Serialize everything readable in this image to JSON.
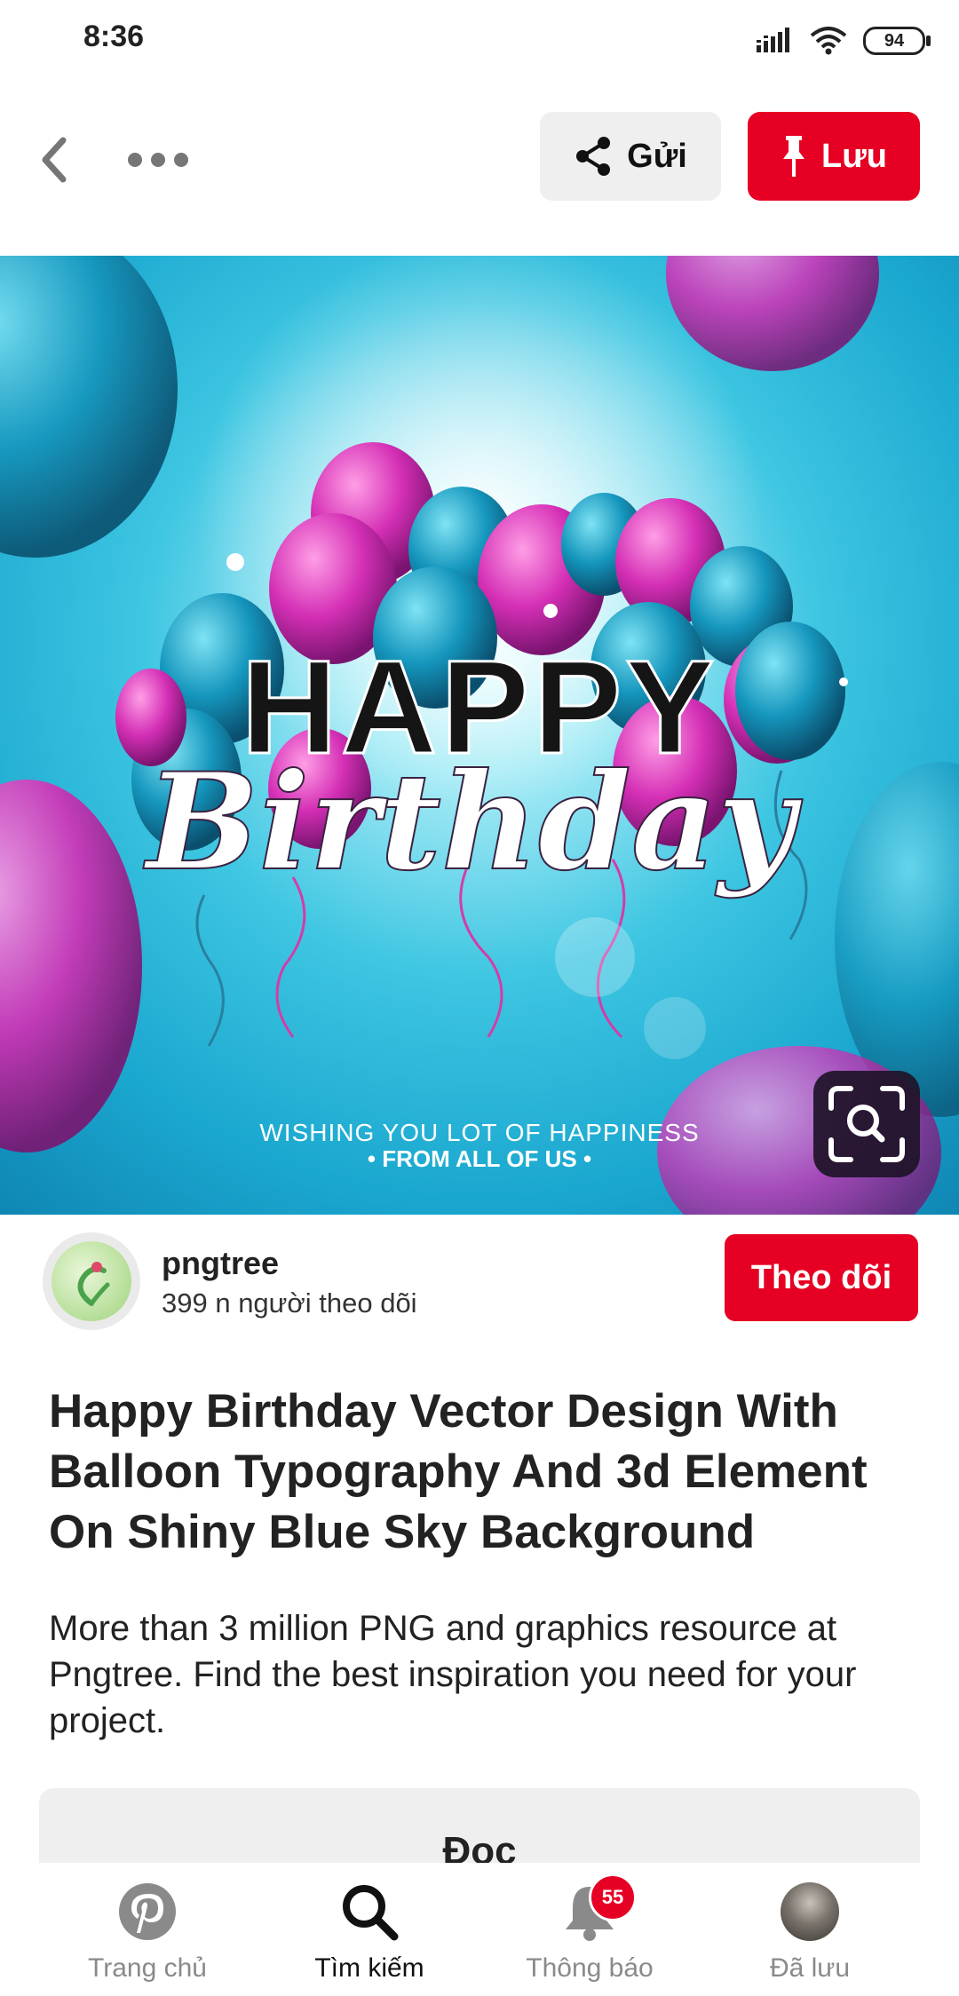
{
  "status_bar": {
    "time": "8:36",
    "battery": "94"
  },
  "topbar": {
    "send_label": "Gửi",
    "save_label": "Lưu"
  },
  "hero": {
    "headline": "HAPPY",
    "script": "Birthday",
    "tagline_1": "WISHING YOU LOT OF HAPPINESS",
    "tagline_2": "• FROM ALL OF US •"
  },
  "creator": {
    "name": "pngtree",
    "followers": "399 n người theo dõi",
    "follow_label": "Theo dõi"
  },
  "pin": {
    "title": "Happy Birthday Vector Design With Balloon Typography And 3d Element On Shiny Blue Sky Background",
    "description": "More than 3 million PNG and graphics resource at Pngtree. Find the best inspiration you need for your project.",
    "read_label": "Đọc"
  },
  "bottom_nav": {
    "items": [
      {
        "label": "Trang chủ",
        "icon": "pinterest-logo-icon"
      },
      {
        "label": "Tìm kiếm",
        "icon": "search-icon"
      },
      {
        "label": "Thông báo",
        "icon": "bell-icon",
        "badge": "55"
      },
      {
        "label": "Đã lưu",
        "icon": "avatar"
      }
    ]
  },
  "colors": {
    "brand_red": "#e60023",
    "button_gray": "#efefef"
  }
}
